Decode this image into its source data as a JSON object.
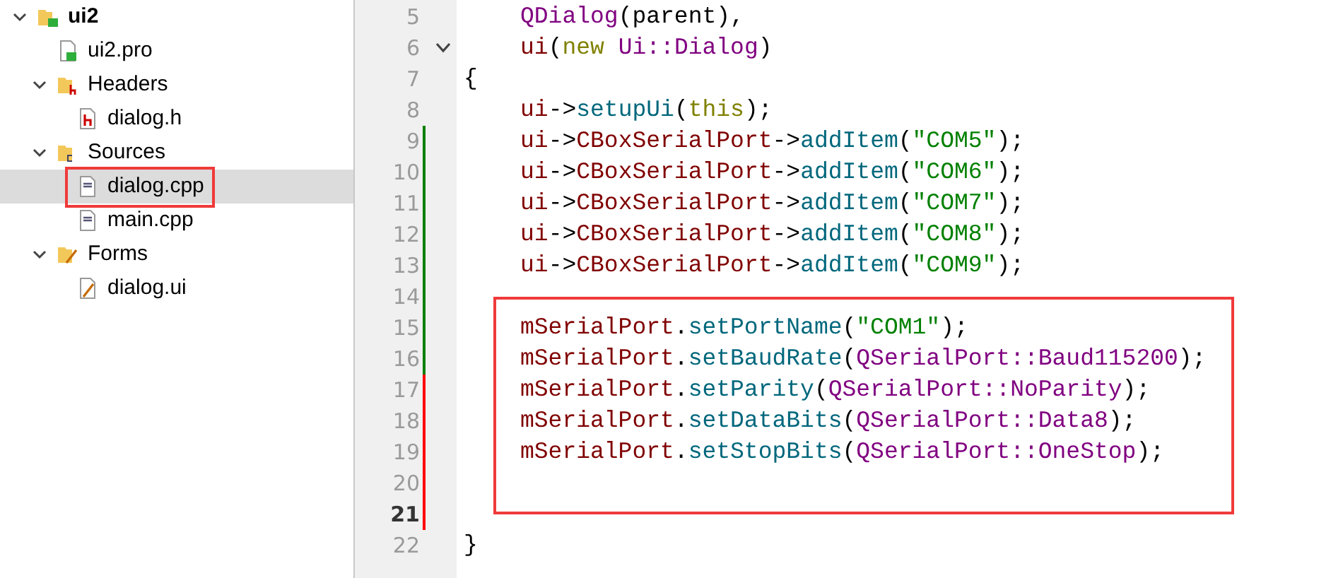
{
  "project_tree": [
    {
      "label": "ui2",
      "kind": "project",
      "expanded": true,
      "selected": false,
      "children": [
        {
          "label": "ui2.pro",
          "kind": "pro",
          "selected": false,
          "annotated": false
        },
        {
          "label": "Headers",
          "kind": "headers",
          "expanded": true,
          "selected": false,
          "children": [
            {
              "label": "dialog.h",
              "kind": "header",
              "selected": false,
              "annotated": false
            }
          ]
        },
        {
          "label": "Sources",
          "kind": "sources",
          "expanded": true,
          "selected": false,
          "children": [
            {
              "label": "dialog.cpp",
              "kind": "source",
              "selected": true,
              "annotated": true
            },
            {
              "label": "main.cpp",
              "kind": "source",
              "selected": false,
              "annotated": false
            }
          ]
        },
        {
          "label": "Forms",
          "kind": "forms",
          "expanded": true,
          "selected": false,
          "children": [
            {
              "label": "dialog.ui",
              "kind": "form",
              "selected": false,
              "annotated": false
            }
          ]
        }
      ]
    }
  ],
  "code_sections": [
    {
      "boxed": false,
      "lines": [
        {
          "number": "5",
          "kind": "body",
          "tokens": [
            {
              "text": "QDialog",
              "kind": "type"
            },
            {
              "text": "(parent),",
              "kind": "plain"
            }
          ]
        },
        {
          "number": "6",
          "kind": "body",
          "fold": {
            "expanded": true
          },
          "tokens": [
            {
              "text": "ui",
              "kind": "member"
            },
            {
              "text": "(",
              "kind": "plain"
            },
            {
              "text": "new",
              "kind": "keyword"
            },
            {
              "text": " Ui::Dialog",
              "kind": "type"
            },
            {
              "text": ")",
              "kind": "plain"
            }
          ]
        },
        {
          "number": "7",
          "kind": "brace",
          "tokens": [
            {
              "text": "{",
              "kind": "plain"
            }
          ]
        },
        {
          "number": "8",
          "kind": "body",
          "tokens": [
            {
              "text": "ui",
              "kind": "member"
            },
            {
              "text": "->",
              "kind": "plain"
            },
            {
              "text": "setupUi",
              "kind": "func"
            },
            {
              "text": "(",
              "kind": "plain"
            },
            {
              "text": "this",
              "kind": "keyword"
            },
            {
              "text": ");",
              "kind": "plain"
            }
          ]
        },
        {
          "number": "9",
          "kind": "body",
          "color": "#008000",
          "tokens": [
            {
              "text": "ui",
              "kind": "member"
            },
            {
              "text": "->",
              "kind": "plain"
            },
            {
              "text": "CBoxSerialPort",
              "kind": "member"
            },
            {
              "text": "->",
              "kind": "plain"
            },
            {
              "text": "addItem",
              "kind": "func"
            },
            {
              "text": "(",
              "kind": "plain"
            },
            {
              "text": "\"COM5\"",
              "kind": "string"
            },
            {
              "text": ");",
              "kind": "plain"
            }
          ]
        },
        {
          "number": "10",
          "kind": "body",
          "color": "#008000",
          "tokens": [
            {
              "text": "ui",
              "kind": "member"
            },
            {
              "text": "->",
              "kind": "plain"
            },
            {
              "text": "CBoxSerialPort",
              "kind": "member"
            },
            {
              "text": "->",
              "kind": "plain"
            },
            {
              "text": "addItem",
              "kind": "func"
            },
            {
              "text": "(",
              "kind": "plain"
            },
            {
              "text": "\"COM6\"",
              "kind": "string"
            },
            {
              "text": ");",
              "kind": "plain"
            }
          ]
        },
        {
          "number": "11",
          "kind": "body",
          "color": "#008000",
          "tokens": [
            {
              "text": "ui",
              "kind": "member"
            },
            {
              "text": "->",
              "kind": "plain"
            },
            {
              "text": "CBoxSerialPort",
              "kind": "member"
            },
            {
              "text": "->",
              "kind": "plain"
            },
            {
              "text": "addItem",
              "kind": "func"
            },
            {
              "text": "(",
              "kind": "plain"
            },
            {
              "text": "\"COM7\"",
              "kind": "string"
            },
            {
              "text": ");",
              "kind": "plain"
            }
          ]
        },
        {
          "number": "12",
          "kind": "body",
          "color": "#008000",
          "tokens": [
            {
              "text": "ui",
              "kind": "member"
            },
            {
              "text": "->",
              "kind": "plain"
            },
            {
              "text": "CBoxSerialPort",
              "kind": "member"
            },
            {
              "text": "->",
              "kind": "plain"
            },
            {
              "text": "addItem",
              "kind": "func"
            },
            {
              "text": "(",
              "kind": "plain"
            },
            {
              "text": "\"COM8\"",
              "kind": "string"
            },
            {
              "text": ");",
              "kind": "plain"
            }
          ]
        },
        {
          "number": "13",
          "kind": "body",
          "color": "#008000",
          "tokens": [
            {
              "text": "ui",
              "kind": "member"
            },
            {
              "text": "->",
              "kind": "plain"
            },
            {
              "text": "CBoxSerialPort",
              "kind": "member"
            },
            {
              "text": "->",
              "kind": "plain"
            },
            {
              "text": "addItem",
              "kind": "func"
            },
            {
              "text": "(",
              "kind": "plain"
            },
            {
              "text": "\"COM9\"",
              "kind": "string"
            },
            {
              "text": ");",
              "kind": "plain"
            }
          ]
        },
        {
          "number": "14",
          "kind": "blank",
          "color": "#008000"
        }
      ]
    },
    {
      "boxed": true,
      "lines": [
        {
          "number": "15",
          "kind": "body",
          "color": "#008000",
          "tokens": [
            {
              "text": "mSerialPort",
              "kind": "member"
            },
            {
              "text": ".",
              "kind": "plain"
            },
            {
              "text": "setPortName",
              "kind": "func"
            },
            {
              "text": "(",
              "kind": "plain"
            },
            {
              "text": "\"COM1\"",
              "kind": "string"
            },
            {
              "text": ");",
              "kind": "plain"
            }
          ]
        },
        {
          "number": "16",
          "kind": "body",
          "color": "#008000",
          "tokens": [
            {
              "text": "mSerialPort",
              "kind": "member"
            },
            {
              "text": ".",
              "kind": "plain"
            },
            {
              "text": "setBaudRate",
              "kind": "func"
            },
            {
              "text": "(",
              "kind": "plain"
            },
            {
              "text": "QSerialPort::Baud115200",
              "kind": "type"
            },
            {
              "text": ");",
              "kind": "plain"
            }
          ]
        },
        {
          "number": "17",
          "kind": "body",
          "color": "#ff0000",
          "tokens": [
            {
              "text": "mSerialPort",
              "kind": "member"
            },
            {
              "text": ".",
              "kind": "plain"
            },
            {
              "text": "setParity",
              "kind": "func"
            },
            {
              "text": "(",
              "kind": "plain"
            },
            {
              "text": "QSerialPort::NoParity",
              "kind": "type"
            },
            {
              "text": ");",
              "kind": "plain"
            }
          ]
        },
        {
          "number": "18",
          "kind": "body",
          "color": "#ff0000",
          "tokens": [
            {
              "text": "mSerialPort",
              "kind": "member"
            },
            {
              "text": ".",
              "kind": "plain"
            },
            {
              "text": "setDataBits",
              "kind": "func"
            },
            {
              "text": "(",
              "kind": "plain"
            },
            {
              "text": "QSerialPort::Data8",
              "kind": "type"
            },
            {
              "text": ");",
              "kind": "plain"
            }
          ]
        },
        {
          "number": "19",
          "kind": "body",
          "color": "#ff0000",
          "tokens": [
            {
              "text": "mSerialPort",
              "kind": "member"
            },
            {
              "text": ".",
              "kind": "plain"
            },
            {
              "text": "setStopBits",
              "kind": "func"
            },
            {
              "text": "(",
              "kind": "plain"
            },
            {
              "text": "QSerialPort::OneStop",
              "kind": "type"
            },
            {
              "text": ");",
              "kind": "plain"
            }
          ]
        },
        {
          "number": "20",
          "kind": "blank",
          "color": "#ff0000"
        },
        {
          "number": "21",
          "kind": "blank",
          "color": "#ff0000",
          "current": true
        }
      ]
    },
    {
      "boxed": false,
      "lines": [
        {
          "number": "22",
          "kind": "brace",
          "tokens": [
            {
              "text": "}",
              "kind": "plain"
            }
          ]
        }
      ]
    }
  ]
}
